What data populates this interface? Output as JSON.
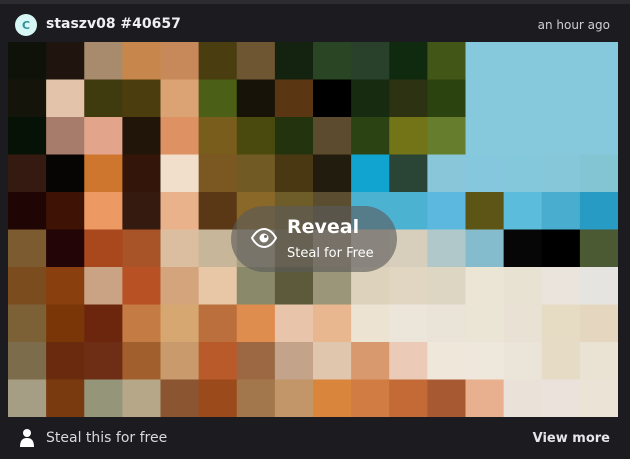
{
  "header": {
    "avatar_letter": "C",
    "username": "staszv08 #40657",
    "timestamp": "an hour ago"
  },
  "overlay": {
    "title": "Reveal",
    "subtitle": "Steal for Free"
  },
  "footer": {
    "text": "Steal this for free",
    "view_more": "View more"
  },
  "icons": {
    "reveal": "eye-icon",
    "footer": "user-icon"
  },
  "mosaic": {
    "rows": [
      [
        "#0f1208",
        "#20140e",
        "#a88a6c",
        "#c7874c",
        "#c7885a",
        "#4a3d10",
        "#6f5632",
        "#142310",
        "#2a4524",
        "#29412a",
        "#0f2a0f",
        "#425617",
        "#86c8dc",
        "#86c8dc",
        "#86c8dc",
        "#86c8dc"
      ],
      [
        "#15140a",
        "#e3c3a9",
        "#403a0f",
        "#4b3d0d",
        "#dba373",
        "#4b5f16",
        "#171308",
        "#5a3612",
        "#000000",
        "#162b0f",
        "#2c3212",
        "#2b440f",
        "#86c8dc",
        "#86c8dc",
        "#86c8dc",
        "#86c8dc"
      ],
      [
        "#071206",
        "#a87c6a",
        "#e2a48a",
        "#211509",
        "#de9162",
        "#795d1c",
        "#4a4a0e",
        "#22330e",
        "#5d4b2f",
        "#2b4312",
        "#727417",
        "#657d2c",
        "#86c8dc",
        "#86c8dc",
        "#86c8dc",
        "#86c8dc"
      ],
      [
        "#341a10",
        "#060503",
        "#ce762e",
        "#331509",
        "#f1dfcb",
        "#7b5822",
        "#715a23",
        "#493812",
        "#221c0e",
        "#12a4d0",
        "#2a4536",
        "#89c6d9",
        "#85c7dd",
        "#84c8dc",
        "#86c7d9",
        "#84c5d3"
      ],
      [
        "#1f0504",
        "#3e1204",
        "#ed9963",
        "#341a0f",
        "#eab28b",
        "#5a3715",
        "#8a6828",
        "#6f5d29",
        "#5a4d30",
        "#4cb2d1",
        "#4cb2d1",
        "#5cb8de",
        "#5c5515",
        "#5bbcdb",
        "#49adcf",
        "#279bc3"
      ],
      [
        "#7d5b30",
        "#230407",
        "#a8481c",
        "#a95328",
        "#dbbd9f",
        "#c8b69a",
        "#a89f80",
        "#7a6c45",
        "#a8977c",
        "#d7c9b7",
        "#d7cfbc",
        "#b1c8ca",
        "#84bcce",
        "#060606",
        "#000000",
        "#4c5a34"
      ],
      [
        "#7b4c1e",
        "#8a3f0f",
        "#c9a384",
        "#b85225",
        "#d4a47c",
        "#e8c7a7",
        "#8a8a6a",
        "#5d5a3b",
        "#9b9679",
        "#ddd2bb",
        "#e1d6c2",
        "#ddd6c3",
        "#ebe5d6",
        "#e8e2d3",
        "#ebe4dd",
        "#e6e4e1"
      ],
      [
        "#7c6036",
        "#7b3608",
        "#6d260e",
        "#c57b44",
        "#d6a771",
        "#ba6f3c",
        "#df8c4f",
        "#e8c5aa",
        "#e9b78f",
        "#ece3d3",
        "#ebe6d9",
        "#eae3d7",
        "#ebe5d6",
        "#e9e1d4",
        "#e6dbc3",
        "#e5d7bf"
      ],
      [
        "#7c6c4c",
        "#6a2a0e",
        "#6d2e15",
        "#a15f2d",
        "#c99a6b",
        "#b95a2b",
        "#9b6843",
        "#c3a38a",
        "#dfc6ad",
        "#d9996e",
        "#ebcbb7",
        "#efe7da",
        "#eee7dc",
        "#eae4d9",
        "#e6dbc5",
        "#eae2d2"
      ],
      [
        "#a69e84",
        "#7a3a0f",
        "#949579",
        "#b5a788",
        "#8b5532",
        "#9b4a1c",
        "#a3774c",
        "#c39669",
        "#d9853c",
        "#d07c43",
        "#c36a37",
        "#a75a32",
        "#e9b08f",
        "#eae2d8",
        "#ebe3db",
        "#ebe3d6"
      ]
    ]
  }
}
